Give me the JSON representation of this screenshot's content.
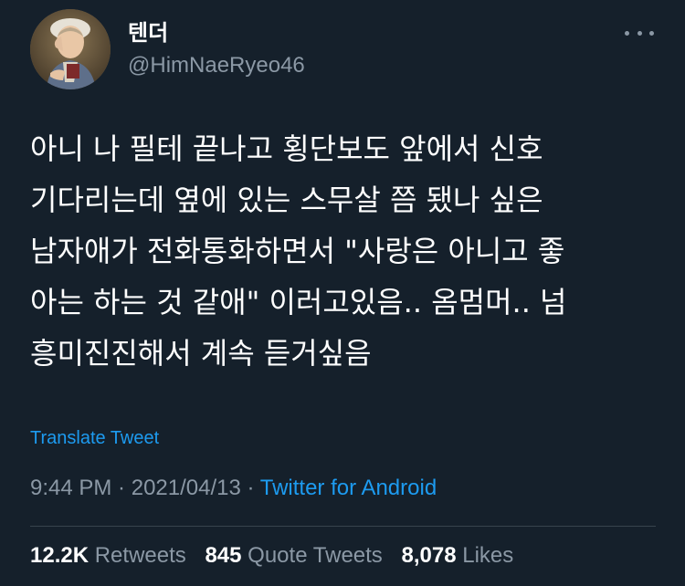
{
  "user": {
    "display_name": "텐더",
    "handle": "@HimNaeRyeo46",
    "avatar_icon": "portrait-painting-avatar"
  },
  "more_icon": "more-horizontal-icon",
  "tweet": {
    "text": "아니 나 필테 끝나고 횡단보도 앞에서 신호\n기다리는데 옆에 있는 스무살 쯤 됐나 싶은\n남자애가 전화통화하면서 \"사랑은 아니고 좋\n아는 하는 것 같애\" 이러고있음.. 옴멈머.. 넘\n흥미진진해서 계속 듣거싶음",
    "translate_label": "Translate Tweet"
  },
  "meta": {
    "time": "9:44 PM",
    "separator": " · ",
    "date": "2021/04/13",
    "source": "Twitter for Android"
  },
  "stats": {
    "retweets_count": "12.2K",
    "retweets_label": "Retweets",
    "quotes_count": "845",
    "quotes_label": "Quote Tweets",
    "likes_count": "8,078",
    "likes_label": "Likes"
  },
  "colors": {
    "background": "#15202b",
    "text": "#ffffff",
    "secondary": "#8b98a5",
    "link": "#1d9bf0",
    "divider": "#38444d"
  }
}
